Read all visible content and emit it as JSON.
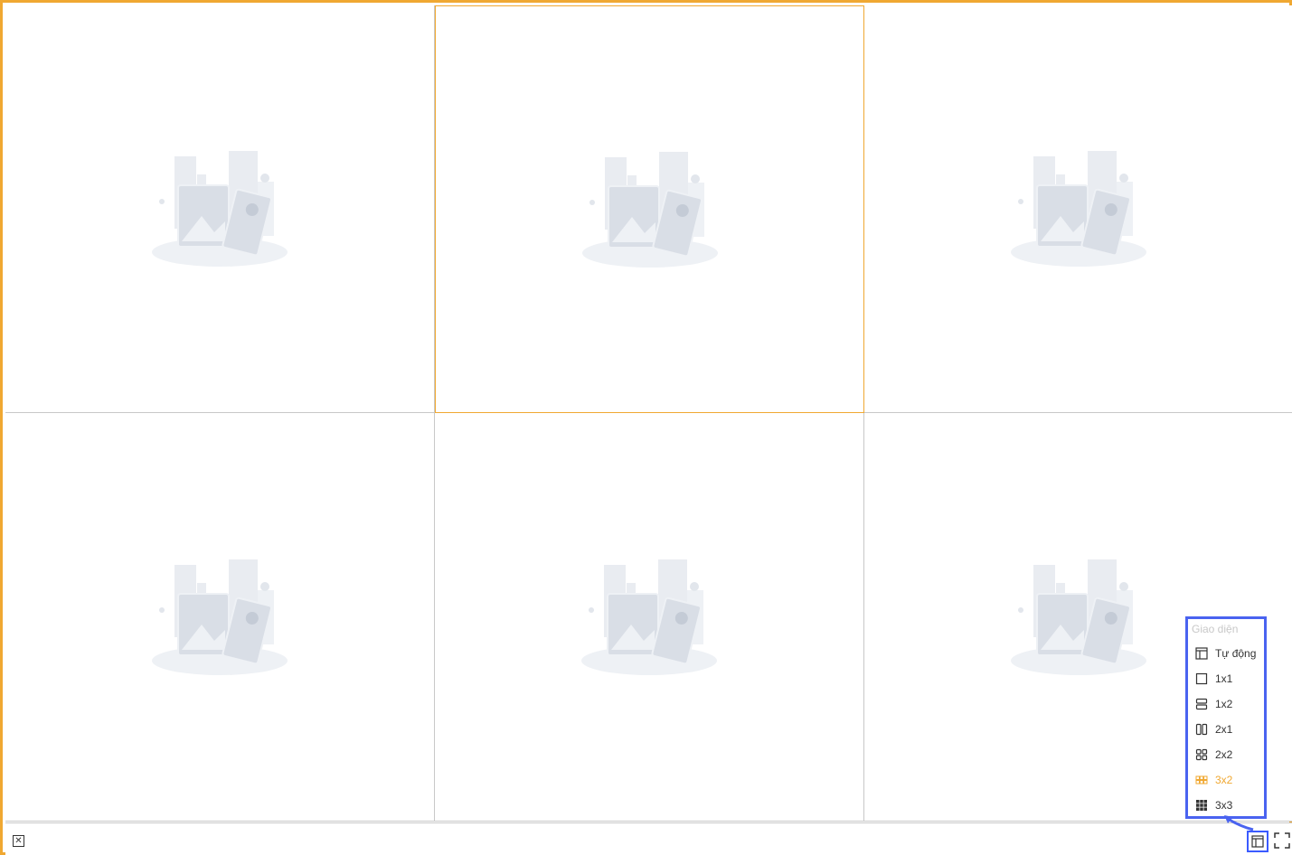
{
  "layout_menu": {
    "title": "Giao diện",
    "items": [
      {
        "label": "Tự động",
        "icon": "auto-layout-icon"
      },
      {
        "label": "1x1",
        "icon": "single-square-icon"
      },
      {
        "label": "1x2",
        "icon": "two-rows-icon"
      },
      {
        "label": "2x1",
        "icon": "two-columns-icon"
      },
      {
        "label": "2x2",
        "icon": "grid-2x2-icon"
      },
      {
        "label": "3x2",
        "icon": "grid-3x2-icon"
      },
      {
        "label": "3x3",
        "icon": "grid-3x3-icon"
      }
    ],
    "selected": "3x2"
  },
  "grid": {
    "layout": "3x2",
    "cells": [
      {
        "state": "empty",
        "icon": "no-image-placeholder-icon"
      },
      {
        "state": "empty",
        "icon": "no-image-placeholder-icon",
        "active": true
      },
      {
        "state": "empty",
        "icon": "no-image-placeholder-icon"
      },
      {
        "state": "empty",
        "icon": "no-image-placeholder-icon"
      },
      {
        "state": "empty",
        "icon": "no-image-placeholder-icon"
      },
      {
        "state": "empty",
        "icon": "no-image-placeholder-icon"
      }
    ]
  },
  "bottom_bar": {
    "close_icon": "close-box-icon",
    "layout_icon": "layout-icon",
    "fullscreen_icon": "fullscreen-icon"
  },
  "colors": {
    "frame": "#f0a832",
    "active_cell": "#f0a832",
    "selected_item": "#f0a832",
    "highlight": "#4a63f0"
  }
}
